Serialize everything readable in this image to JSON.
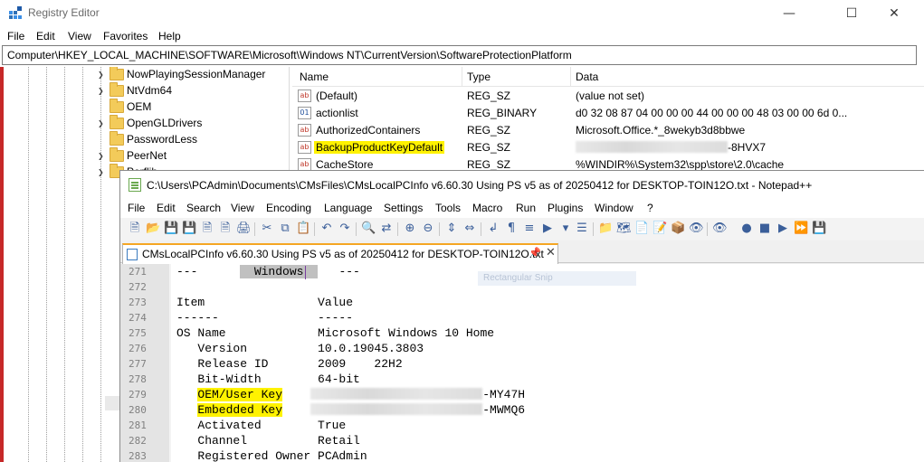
{
  "registry": {
    "title": "Registry Editor",
    "window_controls": {
      "minimize": "—",
      "maximize": "☐",
      "close": "✕"
    },
    "menu": [
      "File",
      "Edit",
      "View",
      "Favorites",
      "Help"
    ],
    "address": "Computer\\HKEY_LOCAL_MACHINE\\SOFTWARE\\Microsoft\\Windows NT\\CurrentVersion\\SoftwareProtectionPlatform",
    "tree_items": [
      "NowPlayingSessionManager",
      "NtVdm64",
      "OEM",
      "OpenGLDrivers",
      "PasswordLess",
      "PeerNet",
      "Perflib"
    ],
    "columns": {
      "name": "Name",
      "type": "Type",
      "data": "Data"
    },
    "values": [
      {
        "name": "(Default)",
        "type": "REG_SZ",
        "data": "(value not set)",
        "icon": "ab"
      },
      {
        "name": "actionlist",
        "type": "REG_BINARY",
        "data": "d0 32 08 87 04 00 00 00 44 00 00 00 48 03 00 00 6d 0...",
        "icon": "bin"
      },
      {
        "name": "AuthorizedContainers",
        "type": "REG_SZ",
        "data": "Microsoft.Office.*_8wekyb3d8bbwe",
        "icon": "ab"
      },
      {
        "name": "BackupProductKeyDefault",
        "type": "REG_SZ",
        "data": "-8HVX7",
        "icon": "ab"
      },
      {
        "name": "CacheStore",
        "type": "REG_SZ",
        "data": "%WINDIR%\\System32\\spp\\store\\2.0\\cache",
        "icon": "ab"
      }
    ],
    "colors": {
      "highlight": "#fff200"
    }
  },
  "notepad": {
    "title": "C:\\Users\\PCAdmin\\Documents\\CMsFiles\\CMsLocalPCInfo v6.60.30 Using PS v5 as of 20250412 for DESKTOP-TOIN12O.txt - Notepad++",
    "menu": [
      "File",
      "Edit",
      "Search",
      "View",
      "Encoding",
      "Language",
      "Settings",
      "Tools",
      "Macro",
      "Run",
      "Plugins",
      "Window",
      "?"
    ],
    "tab_label": "CMsLocalPCInfo v6.60.30 Using PS v5 as of 20250412 for DESKTOP-TOIN12O.txt",
    "tab_pin": "📌",
    "tab_close": "✕",
    "ghost_tooltip": "Rectangular Snip",
    "lines": [
      {
        "num": "271",
        "pre": "---      ",
        "sel": "  Windows  ",
        "post": "   ---"
      },
      {
        "num": "272",
        "text": ""
      },
      {
        "num": "273",
        "text": "Item                Value"
      },
      {
        "num": "274",
        "text": "------              -----"
      },
      {
        "num": "275",
        "text": "OS Name             Microsoft Windows 10 Home"
      },
      {
        "num": "276",
        "text": "   Version          10.0.19045.3803"
      },
      {
        "num": "277",
        "text": "   Release ID       2009    22H2"
      },
      {
        "num": "278",
        "text": "   Bit-Width        64-bit"
      },
      {
        "num": "279",
        "key": "OEM/User Key",
        "tail": "-MY47H"
      },
      {
        "num": "280",
        "key": "Embedded Key",
        "tail": "-MWMQ6"
      },
      {
        "num": "281",
        "text": "   Activated        True"
      },
      {
        "num": "282",
        "text": "   Channel          Retail"
      },
      {
        "num": "283",
        "text": "   Registered Owner PCAdmin"
      }
    ]
  }
}
